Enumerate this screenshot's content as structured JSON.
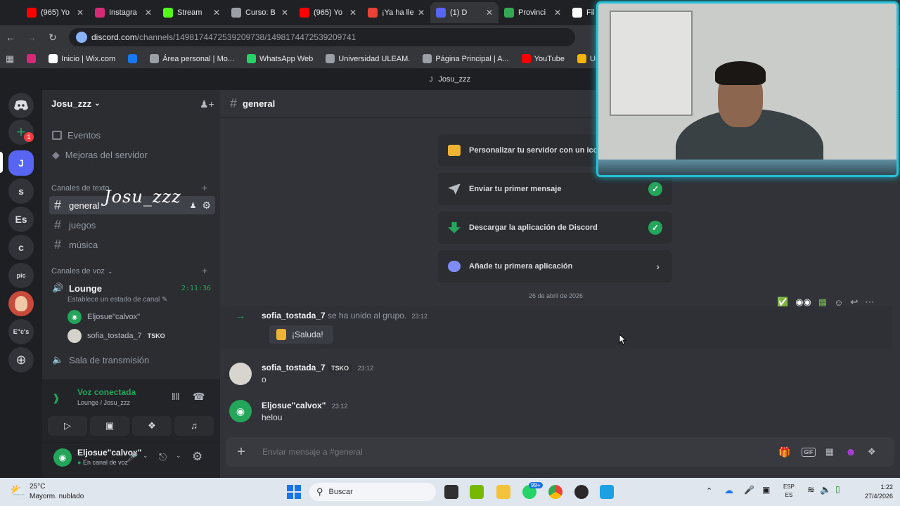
{
  "browser": {
    "tabs": [
      {
        "label": "(965) Yo",
        "color": "#ff0000"
      },
      {
        "label": "Instagra",
        "color": "#d62976"
      },
      {
        "label": "Stream",
        "color": "#53fc18"
      },
      {
        "label": "Curso: B",
        "color": "#9aa0a6"
      },
      {
        "label": "(965) Yo",
        "color": "#ff0000"
      },
      {
        "label": "¡Ya ha lle",
        "color": "#ea4335"
      },
      {
        "label": "(1) D",
        "color": "#5865f2"
      },
      {
        "label": "Provinci",
        "color": "#34a853"
      },
      {
        "label": "Fil",
        "color": "#ffffff"
      }
    ],
    "url_host": "discord.com",
    "url_path": "/channels/1498174472539209738/1498174472539209741",
    "bookmarks": [
      {
        "label": "",
        "color": "#d62976"
      },
      {
        "label": "Inicio | Wix.com",
        "color": "#ffffff"
      },
      {
        "label": "",
        "color": "#1877f2"
      },
      {
        "label": "Área personal | Mo...",
        "color": "#9aa0a6"
      },
      {
        "label": "WhatsApp Web",
        "color": "#25d366"
      },
      {
        "label": "Universidad ULEAM.",
        "color": "#9aa0a6"
      },
      {
        "label": "Página Principal | A...",
        "color": "#9aa0a6"
      },
      {
        "label": "YouTube",
        "color": "#ff0000"
      },
      {
        "label": "Unitips | Cursos pa",
        "color": "#f4b400"
      }
    ]
  },
  "window_title": "Josu_zzz",
  "rail": {
    "servers": [
      "J",
      "s",
      "Es",
      "c",
      "pic",
      "E\"c's"
    ],
    "badge": "1"
  },
  "sidebar": {
    "server_name": "Josu_zzz",
    "events_label": "Eventos",
    "boosts_label": "Mejoras del servidor",
    "text_category": "Canales de texto",
    "text_channels": [
      "general",
      "juegos",
      "música"
    ],
    "handwriting": "Josu_zzz",
    "voice_category": "Canales de voz",
    "voice_channel": "Lounge",
    "voice_timer": "2:11:36",
    "voice_status": "Establece un estado de canal",
    "voice_members": [
      {
        "name": "Eljosue\"calvox\"",
        "tag": ""
      },
      {
        "name": "sofia_tostada_7",
        "tag": "TSKO"
      }
    ],
    "stage_channel": "Sala de transmisión"
  },
  "voice_panel": {
    "status": "Voz conectada",
    "location": "Lounge / Josu_zzz"
  },
  "user_panel": {
    "username": "Eljosue\"calvox\"",
    "status": "En canal de voz"
  },
  "chat": {
    "channel": "general",
    "checklist": [
      {
        "label": "Personalizar tu servidor con un icono",
        "done": true
      },
      {
        "label": "Enviar tu primer mensaje",
        "done": true
      },
      {
        "label": "Descargar la aplicación de Discord",
        "done": true
      },
      {
        "label": "Añade tu primera aplicación",
        "done": false
      }
    ],
    "date_divider": "26 de abril de 2026",
    "join": {
      "name": "sofia_tostada_7",
      "text": "se ha unido al grupo.",
      "time": "23:12",
      "wave_label": "¡Saluda!"
    },
    "messages": [
      {
        "name": "sofia_tostada_7",
        "tag": "TSKO",
        "time": "23:12",
        "text": "o"
      },
      {
        "name": "Eljosue\"calvox\"",
        "tag": "",
        "time": "23:12",
        "text": "helou"
      }
    ],
    "composer_placeholder": "Enviar mensaje a #general"
  },
  "taskbar": {
    "weather_temp": "25°C",
    "weather_desc": "Mayorm. nublado",
    "search_placeholder": "Buscar",
    "badge": "99+",
    "lang1": "ESP",
    "lang2": "ES",
    "time": "1:22",
    "date": "27/4/2026"
  },
  "colors": {
    "accent": "#5865f2",
    "green": "#23a55a",
    "cam_border": "#27c1d6"
  }
}
